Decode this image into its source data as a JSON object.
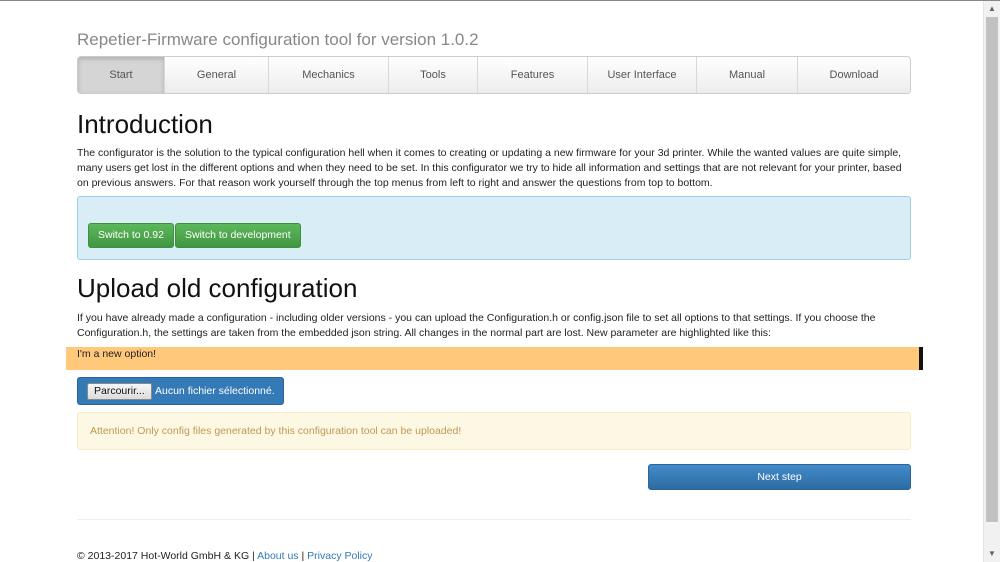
{
  "app": {
    "title": "Repetier-Firmware configuration tool for version 1.0.2"
  },
  "nav": {
    "items": [
      {
        "label": "Start",
        "active": true
      },
      {
        "label": "General"
      },
      {
        "label": "Mechanics"
      },
      {
        "label": "Tools"
      },
      {
        "label": "Features"
      },
      {
        "label": "User Interface"
      },
      {
        "label": "Manual"
      },
      {
        "label": "Download"
      }
    ]
  },
  "intro": {
    "heading": "Introduction",
    "text": "The configurator is the solution to the typical configuration hell when it comes to creating or updating a new firmware for your 3d printer. While the wanted values are quite simple, many users get lost in the different options and when they need to be set. In this configurator we try to hide all information and settings that are not relevant for your printer, based on previous answers. For that reason work yourself through the top menus from left to right and answer the questions from top to bottom.",
    "switch_092": "Switch to 0.92",
    "switch_dev": "Switch to development"
  },
  "upload": {
    "heading": "Upload old configuration",
    "text": "If you have already made a configuration - including older versions - you can upload the Configuration.h or config.json file to set all options to that settings. If you choose the Configuration.h, the settings are taken from the embedded json string. All changes in the normal part are lost. New parameter are highlighted like this:",
    "new_option": "I'm a new option!",
    "browse_label": "Parcourir...",
    "file_status": "Aucun fichier sélectionné.",
    "warning": "Attention! Only config files generated by this configuration tool can be uploaded!"
  },
  "actions": {
    "next": "Next step"
  },
  "footer": {
    "copyright": "© 2013-2017 Hot-World GmbH & KG |",
    "about": "About us",
    "sep": "|",
    "privacy": "Privacy Policy"
  },
  "colors": {
    "accent": "#337ab7",
    "success": "#5cb85c",
    "info_bg": "#d9edf7",
    "warning_bg": "#fcf8e3",
    "highlight": "#ffc87a"
  }
}
